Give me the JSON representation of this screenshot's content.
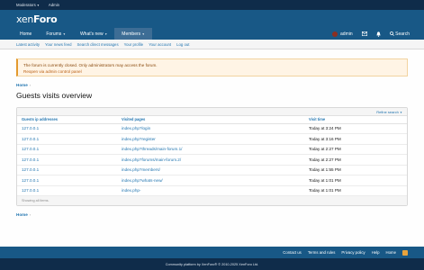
{
  "staffbar": {
    "moderators": "Moderators",
    "admin": "Admin"
  },
  "header": {
    "logo_a": "xen",
    "logo_b": "Foro"
  },
  "nav": {
    "tabs": [
      {
        "label": "Home"
      },
      {
        "label": "Forums"
      },
      {
        "label": "What's new"
      },
      {
        "label": "Members"
      }
    ],
    "user": "admin",
    "search": "Search"
  },
  "subnav": [
    "Latest activity",
    "Your news feed",
    "Search direct messages",
    "Your profile",
    "Your account",
    "Log out"
  ],
  "notice": {
    "line1": "The forum is currently closed. Only administrators may access the forum.",
    "line2": "Reopen via admin control panel"
  },
  "breadcrumb": "Home",
  "page_title": "Guests visits overview",
  "filter_label": "Refine search",
  "table": {
    "headers": [
      "Guests ip addresses",
      "Visited pages",
      "Visit time"
    ],
    "rows": [
      {
        "ip": "127.0.0.1",
        "page": "index.php?login",
        "time": "Today at 3:24 PM"
      },
      {
        "ip": "127.0.0.1",
        "page": "index.php?register",
        "time": "Today at 3:16 PM"
      },
      {
        "ip": "127.0.0.1",
        "page": "index.php?threads/main-forum.1/",
        "time": "Today at 2:27 PM"
      },
      {
        "ip": "127.0.0.1",
        "page": "index.php?forums/main-forum.2/",
        "time": "Today at 2:27 PM"
      },
      {
        "ip": "127.0.0.1",
        "page": "index.php?members/",
        "time": "Today at 1:55 PM"
      },
      {
        "ip": "127.0.0.1",
        "page": "index.php?whats-new/",
        "time": "Today at 1:01 PM"
      },
      {
        "ip": "127.0.0.1",
        "page": "index.php-",
        "time": "Today at 1:01 PM"
      }
    ],
    "footer": "Showing all items."
  },
  "footer": {
    "links": [
      "Contact us",
      "Terms and rules",
      "Privacy policy",
      "Help",
      "Home"
    ],
    "copyright": "Community platform by XenForo® © 2010-2025 XenForo Ltd."
  },
  "colors": {
    "header": "#185886",
    "dark": "#0f2c4a",
    "link": "#2577b1"
  }
}
